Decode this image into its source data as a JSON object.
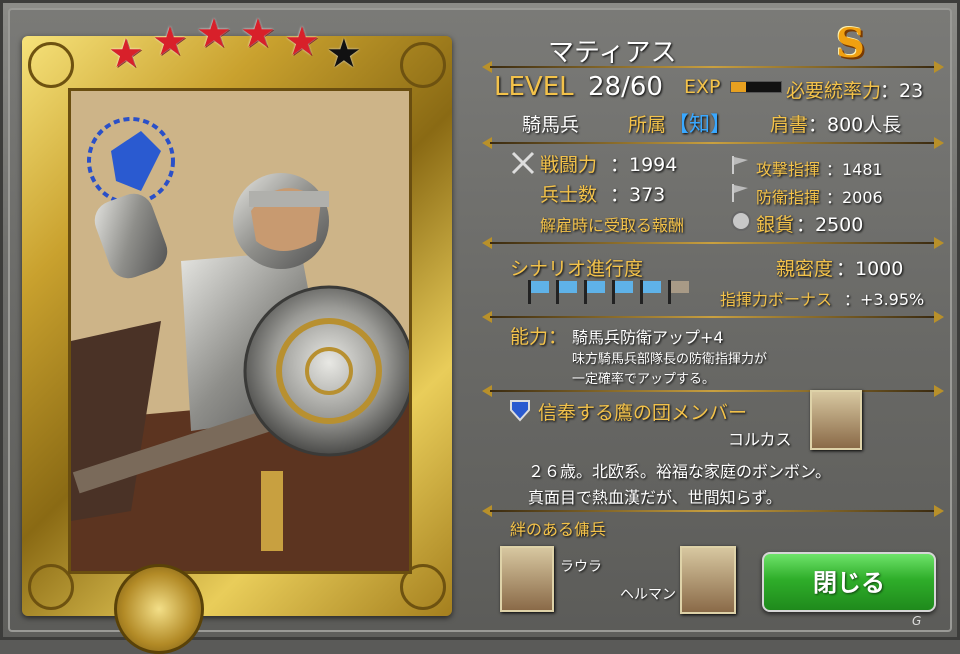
{
  "unit": {
    "name": "マティアス",
    "rank": "S",
    "level_label": "LEVEL",
    "level_value": "28/60",
    "exp_label": "EXP",
    "exp_progress": 0.3,
    "command_req_label": "必要統率力",
    "command_req_value": "：23",
    "class": "騎馬兵",
    "affiliation_label": "所属",
    "affiliation_value": "【知】",
    "title_label": "肩書",
    "title_value": "：800人長",
    "rarity_stars_filled": 5,
    "rarity_stars_total": 6
  },
  "stats": {
    "battle_power_label": "戦闘力",
    "battle_power_value": "：1994",
    "soldiers_label": "兵士数",
    "soldiers_value": "：373",
    "attack_cmd_label": "攻撃指揮",
    "attack_cmd_value": "：1481",
    "defense_cmd_label": "防衛指揮",
    "defense_cmd_value": "：2006",
    "dismiss_reward_label": "解雇時に受取る報酬",
    "silver_label": "銀貨",
    "silver_value": "：2500"
  },
  "progress": {
    "scenario_label": "シナリオ進行度",
    "scenario_flags_completed": 5,
    "scenario_flags_total": 6,
    "intimacy_label": "親密度",
    "intimacy_value": "：1000",
    "command_bonus_label": "指揮力ボーナス",
    "command_bonus_value": "：+3.95%"
  },
  "ability": {
    "label": "能力：",
    "name": "騎馬兵防衛アップ+4",
    "desc_line1": "味方騎馬兵部隊長の防衛指揮力が",
    "desc_line2": "一定確率でアップする。"
  },
  "faction": {
    "name": "信奉する鷹の団メンバー",
    "member_name": "コルカス"
  },
  "bio": {
    "line1": "２６歳。北欧系。裕福な家庭のボンボン。",
    "line2": "真面目で熱血漢だが、世間知らず。"
  },
  "bonds": {
    "label": "絆のある傭兵",
    "members": [
      {
        "name": "ラウラ"
      },
      {
        "name": "ヘルマン"
      }
    ]
  },
  "buttons": {
    "close": "閉じる"
  },
  "watermark": "G"
}
